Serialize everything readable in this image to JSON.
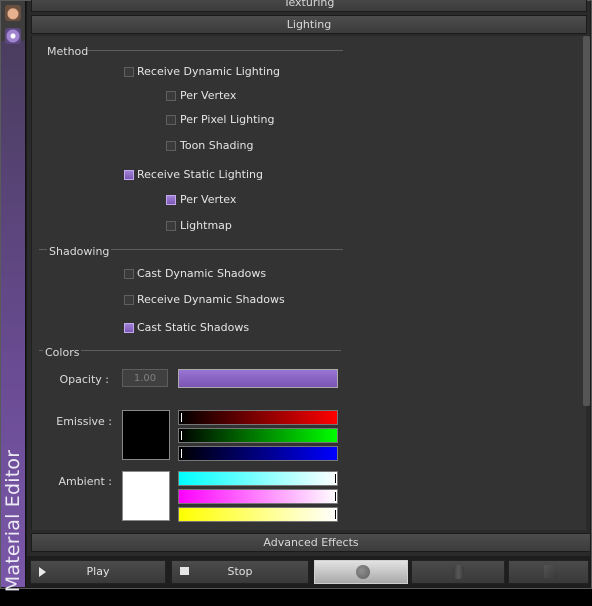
{
  "app": {
    "side_title": "Material Editor"
  },
  "sections": {
    "texturing_label": "Texturing",
    "lighting_label": "Lighting",
    "advanced_label": "Advanced Effects"
  },
  "method": {
    "label": "Method",
    "receive_dynamic": {
      "label": "Receive Dynamic Lighting",
      "checked": false
    },
    "per_vertex": {
      "label": "Per Vertex",
      "checked": false
    },
    "per_pixel": {
      "label": "Per Pixel Lighting",
      "checked": false
    },
    "toon": {
      "label": "Toon Shading",
      "checked": false
    },
    "receive_static": {
      "label": "Receive Static Lighting",
      "checked": true
    },
    "static_per_vertex": {
      "label": "Per Vertex",
      "checked": true
    },
    "lightmap": {
      "label": "Lightmap",
      "checked": false
    }
  },
  "shadowing": {
    "label": "Shadowing",
    "cast_dynamic": {
      "label": "Cast Dynamic Shadows",
      "checked": false
    },
    "receive_dynamic": {
      "label": "Receive Dynamic Shadows",
      "checked": false
    },
    "cast_static": {
      "label": "Cast Static Shadows",
      "checked": true
    }
  },
  "colors": {
    "label": "Colors",
    "opacity_label": "Opacity :",
    "opacity_value": "1.00",
    "emissive_label": "Emissive :",
    "ambient_label": "Ambient :",
    "emissive_color": "#000000",
    "ambient_color": "#ffffff",
    "accent_color": "#8a63c2"
  },
  "toolbar": {
    "play_label": "Play",
    "stop_label": "Stop",
    "preview_shapes": [
      "sphere-icon",
      "cylinder-icon",
      "cube-icon"
    ]
  }
}
